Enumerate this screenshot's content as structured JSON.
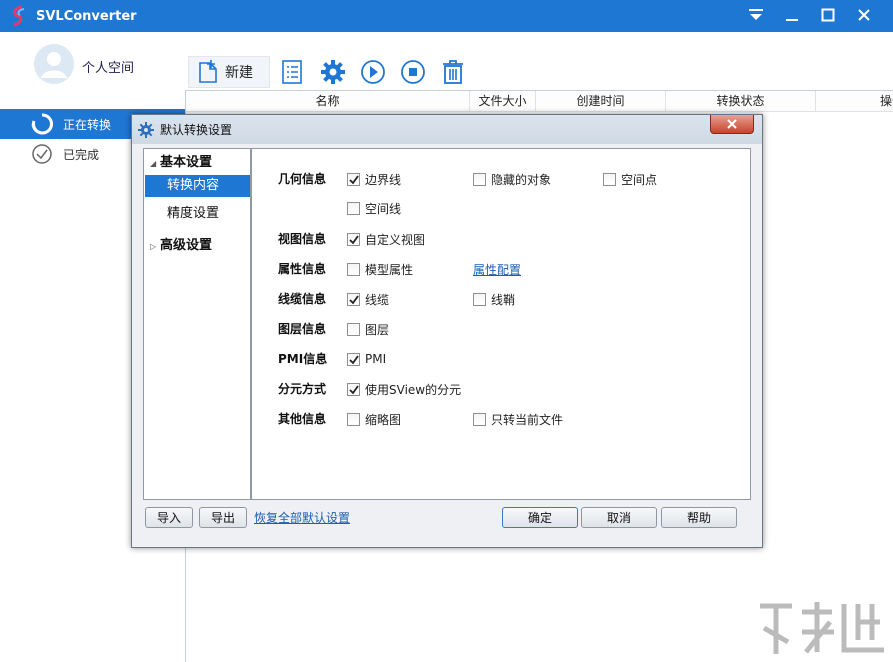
{
  "app": {
    "title": "SVLConverter"
  },
  "window_icons": [
    "menu-icon",
    "minimize-icon",
    "maximize-icon",
    "close-icon"
  ],
  "user": {
    "name": "个人空间"
  },
  "sidebar": {
    "items": [
      {
        "label": "正在转换",
        "icon": "converting-icon",
        "active": true
      },
      {
        "label": "已完成",
        "icon": "check-circle-icon",
        "active": false
      }
    ]
  },
  "toolbar": {
    "new_label": "新建",
    "icons": [
      "task-list-icon",
      "settings-gear-icon",
      "play-icon",
      "stop-icon",
      "trash-icon"
    ]
  },
  "table": {
    "columns": [
      "名称",
      "文件大小",
      "创建时间",
      "转换状态",
      "操作"
    ]
  },
  "dialog": {
    "title": "默认转换设置",
    "tree": {
      "basic": "基本设置",
      "content": "转换内容",
      "precision": "精度设置",
      "advanced": "高级设置"
    },
    "rows": {
      "geometry": {
        "label": "几何信息",
        "opts": [
          {
            "label": "边界线",
            "checked": true
          },
          {
            "label": "隐藏的对象",
            "checked": false
          },
          {
            "label": "空间点",
            "checked": false
          },
          {
            "label": "空间线",
            "checked": false
          }
        ]
      },
      "view": {
        "label": "视图信息",
        "opts": [
          {
            "label": "自定义视图",
            "checked": true
          }
        ]
      },
      "attr": {
        "label": "属性信息",
        "opts": [
          {
            "label": "模型属性",
            "checked": false
          }
        ],
        "link": "属性配置"
      },
      "cable": {
        "label": "线缆信息",
        "opts": [
          {
            "label": "线缆",
            "checked": true
          },
          {
            "label": "线鞘",
            "checked": false
          }
        ]
      },
      "layer": {
        "label": "图层信息",
        "opts": [
          {
            "label": "图层",
            "checked": false
          }
        ]
      },
      "pmi": {
        "label": "PMI信息",
        "opts": [
          {
            "label": "PMI",
            "checked": true
          }
        ]
      },
      "split": {
        "label": "分元方式",
        "opts": [
          {
            "label": "使用SView的分元",
            "checked": true
          }
        ]
      },
      "other": {
        "label": "其他信息",
        "opts": [
          {
            "label": "缩略图",
            "checked": false
          },
          {
            "label": "只转当前文件",
            "checked": false
          }
        ]
      }
    },
    "buttons": {
      "import": "导入",
      "export": "导出",
      "restore": "恢复全部默认设置",
      "ok": "确定",
      "cancel": "取消",
      "help": "帮助"
    }
  },
  "colors": {
    "accent": "#1f77d4",
    "titlebar": "#1f77d4",
    "close_red": "#c8432c"
  }
}
